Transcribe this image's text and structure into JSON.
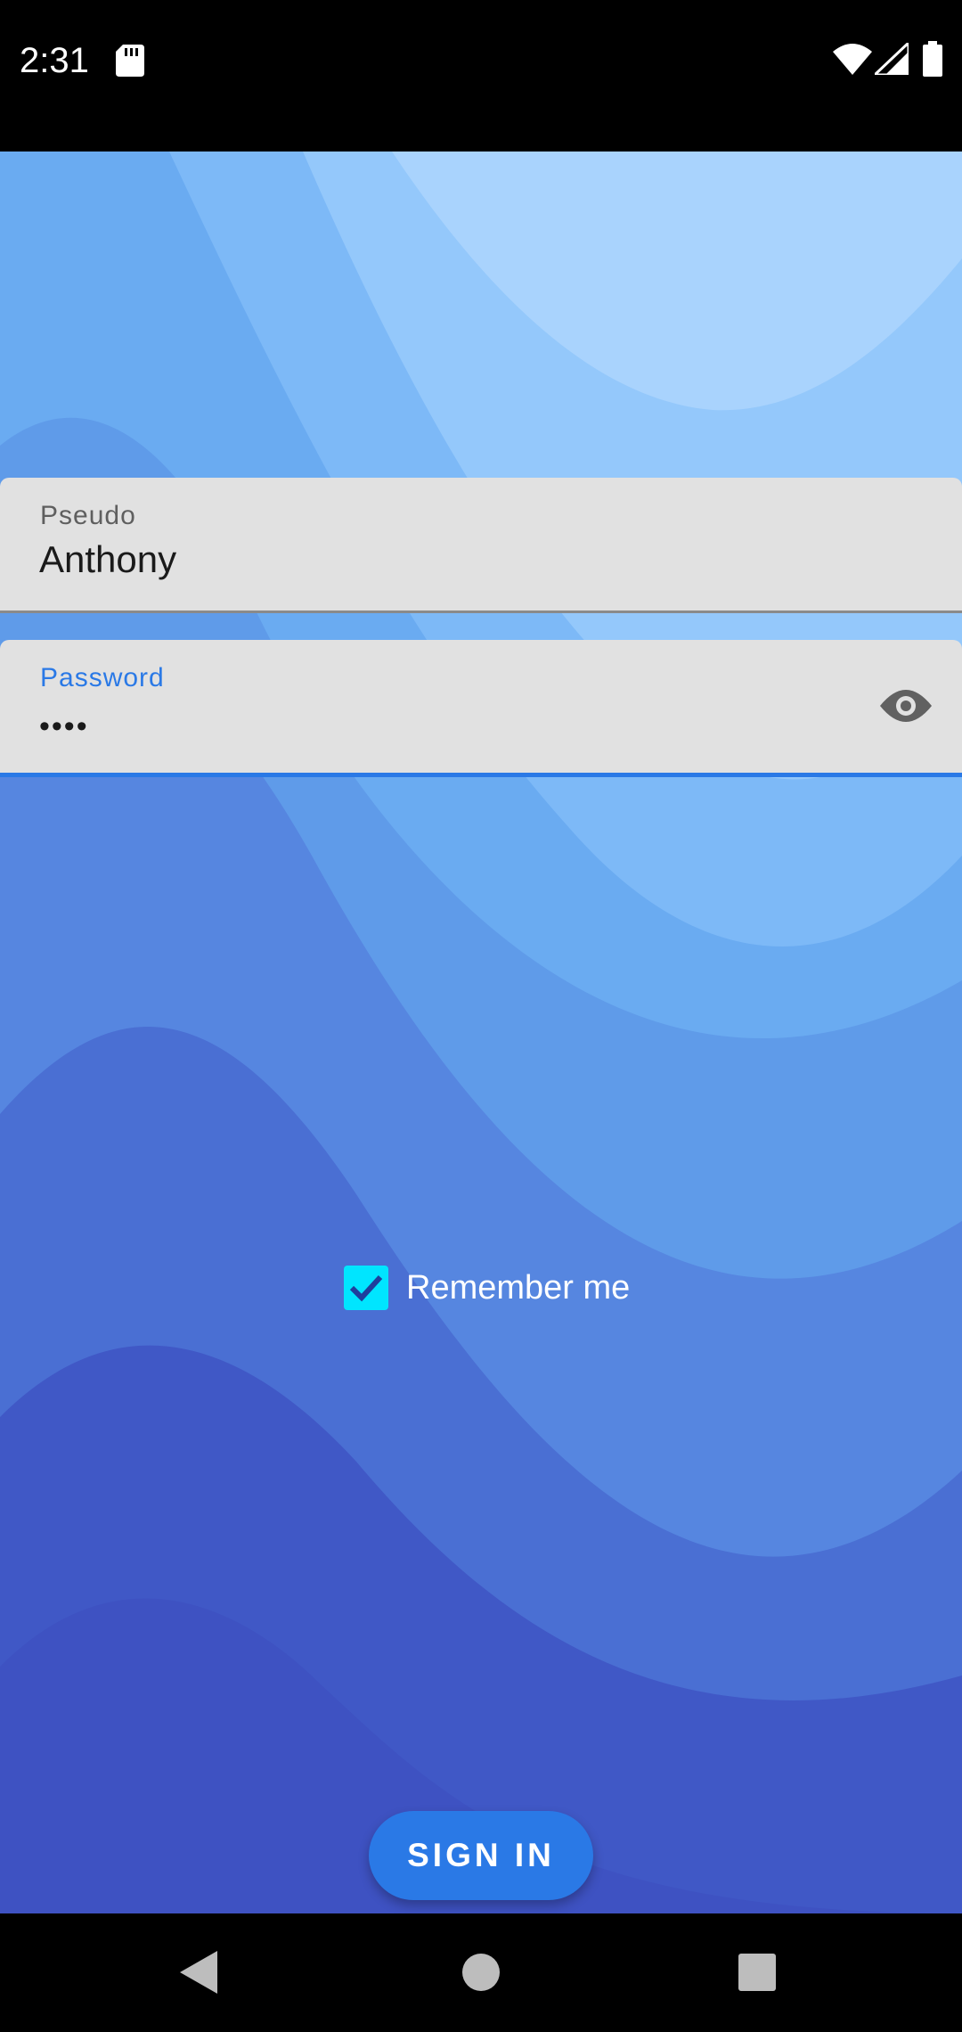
{
  "status_bar": {
    "time": "2:31",
    "icons": [
      "sd-card-icon",
      "wifi-icon",
      "cell-signal-icon",
      "battery-icon"
    ]
  },
  "login_form": {
    "pseudo_field": {
      "label": "Pseudo",
      "value": "Anthony"
    },
    "password_field": {
      "label": "Password",
      "masked_value": "••••",
      "toggle_icon": "eye-icon"
    },
    "remember_me": {
      "label": "Remember me",
      "checked": true
    },
    "sign_in_label": "SIGN IN"
  },
  "colors": {
    "accent": "#2a79e6",
    "checkbox": "#00e5ff",
    "field_background": "#e1e1e1",
    "background_light": "#a9d3fd",
    "background_dark": "#3a4fc0"
  },
  "nav_bar": {
    "icons": [
      "back-icon",
      "home-icon",
      "recents-icon"
    ]
  }
}
